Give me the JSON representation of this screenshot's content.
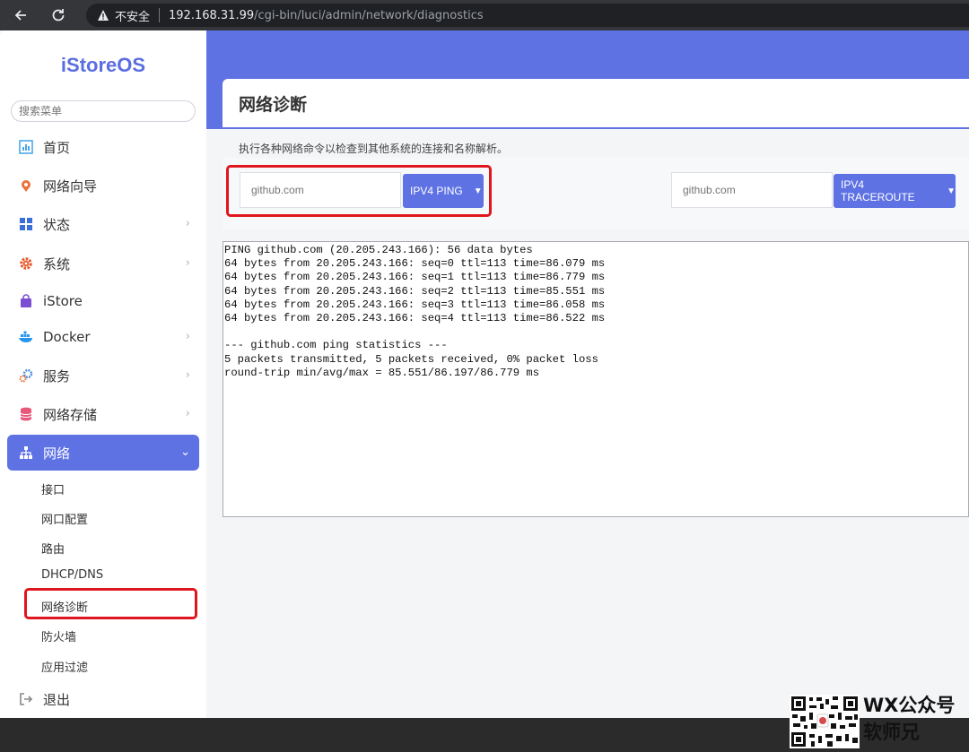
{
  "browser": {
    "security_label": "不安全",
    "url_host": "192.168.31.99",
    "url_path": "/cgi-bin/luci/admin/network/diagnostics"
  },
  "sidebar": {
    "logo": "iStoreOS",
    "search_placeholder": "搜索菜单",
    "items": [
      {
        "label": "首页",
        "icon": "dashboard-icon",
        "color": "#4aa8e8"
      },
      {
        "label": "网络向导",
        "icon": "location-pin-icon",
        "color": "#e8743b"
      },
      {
        "label": "状态",
        "icon": "grid-icon",
        "color": "#3a6fd8"
      },
      {
        "label": "系统",
        "icon": "gear-icon",
        "color": "#e85a2b"
      },
      {
        "label": "iStore",
        "icon": "bag-icon",
        "color": "#7b4fd1"
      },
      {
        "label": "Docker",
        "icon": "docker-icon",
        "color": "#2496ed"
      },
      {
        "label": "服务",
        "icon": "cogs-icon",
        "color": "#4a8fe0"
      },
      {
        "label": "网络存储",
        "icon": "database-icon",
        "color": "#e8577a"
      },
      {
        "label": "网络",
        "icon": "network-tree-icon",
        "color": "#ffffff"
      }
    ],
    "sub_items": [
      "接口",
      "网口配置",
      "路由",
      "DHCP/DNS",
      "网络诊断",
      "防火墙",
      "应用过滤"
    ],
    "logout": "退出"
  },
  "main": {
    "title": "网络诊断",
    "description": "执行各种网络命令以检查到其他系统的连接和名称解析。",
    "ping": {
      "placeholder": "github.com",
      "button": "IPV4 PING"
    },
    "traceroute": {
      "placeholder": "github.com",
      "button": "IPV4 TRACEROUTE"
    },
    "output": "PING github.com (20.205.243.166): 56 data bytes\n64 bytes from 20.205.243.166: seq=0 ttl=113 time=86.079 ms\n64 bytes from 20.205.243.166: seq=1 ttl=113 time=86.779 ms\n64 bytes from 20.205.243.166: seq=2 ttl=113 time=85.551 ms\n64 bytes from 20.205.243.166: seq=3 ttl=113 time=86.058 ms\n64 bytes from 20.205.243.166: seq=4 ttl=113 time=86.522 ms\n\n--- github.com ping statistics ---\n5 packets transmitted, 5 packets received, 0% packet loss\nround-trip min/avg/max = 85.551/86.197/86.779 ms"
  },
  "watermark": {
    "line1": "WX公众号",
    "line2": "软师兄"
  },
  "colors": {
    "accent": "#5e72e4",
    "highlight": "#e0161e"
  }
}
